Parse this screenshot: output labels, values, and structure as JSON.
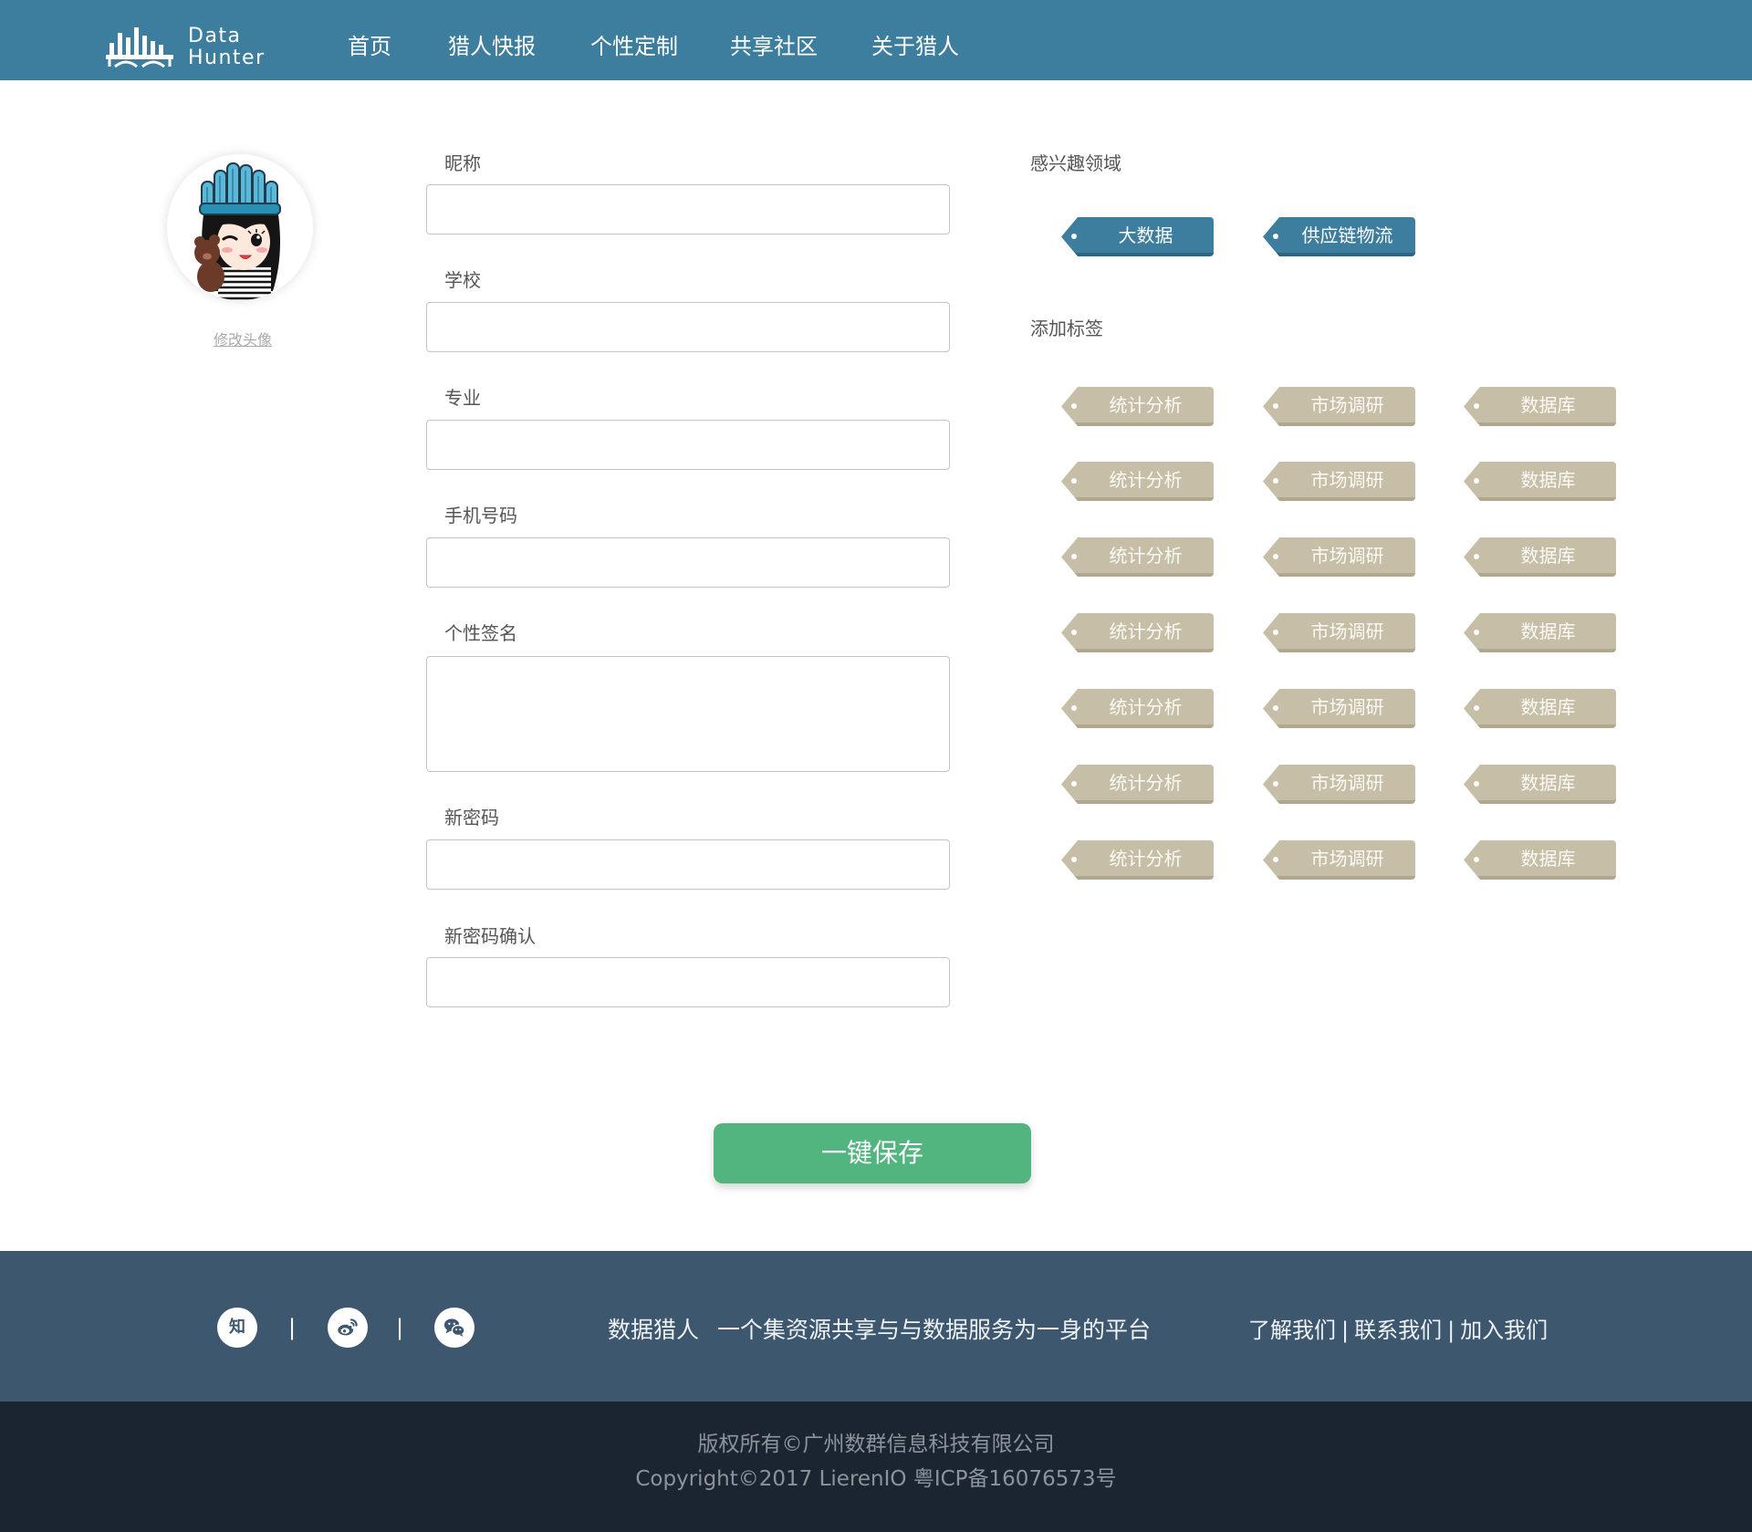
{
  "colors": {
    "header_bg": "#3d7d9d",
    "selected_tag": "#3d7d9d",
    "add_tag": "#c6bea6",
    "save_button": "#52b57f",
    "footer_bg": "#3d576f",
    "copyright_bg": "#1b2532"
  },
  "header": {
    "logo": {
      "line1": "Data",
      "line2": "Hunter",
      "icon": "skyline-bars-icon"
    },
    "nav": [
      {
        "label": "首页"
      },
      {
        "label": "猎人快报"
      },
      {
        "label": "个性定制"
      },
      {
        "label": "共享社区"
      },
      {
        "label": "关于猎人"
      }
    ]
  },
  "profile": {
    "avatar": "cartoon-girl-avatar",
    "change_avatar_link": "修改头像"
  },
  "form": {
    "fields": [
      {
        "label": "昵称",
        "value": ""
      },
      {
        "label": "学校",
        "value": ""
      },
      {
        "label": "专业",
        "value": ""
      },
      {
        "label": "手机号码",
        "value": ""
      },
      {
        "label": "个性签名",
        "value": ""
      },
      {
        "label": "新密码",
        "value": ""
      },
      {
        "label": "新密码确认",
        "value": ""
      }
    ]
  },
  "interests": {
    "title": "感兴趣领域",
    "selected_tags": [
      "大数据",
      "供应链物流"
    ]
  },
  "add_tags": {
    "title": "添加标签",
    "rows": [
      [
        "统计分析",
        "市场调研",
        "数据库"
      ],
      [
        "统计分析",
        "市场调研",
        "数据库"
      ],
      [
        "统计分析",
        "市场调研",
        "数据库"
      ],
      [
        "统计分析",
        "市场调研",
        "数据库"
      ],
      [
        "统计分析",
        "市场调研",
        "数据库"
      ],
      [
        "统计分析",
        "市场调研",
        "数据库"
      ],
      [
        "统计分析",
        "市场调研",
        "数据库"
      ]
    ]
  },
  "save_button": {
    "label": "一键保存"
  },
  "footer": {
    "social": [
      {
        "icon": "zhihu-icon",
        "glyph": "知"
      },
      {
        "icon": "weibo-icon"
      },
      {
        "icon": "wechat-icon"
      }
    ],
    "separator": "|",
    "brand": "数据猎人",
    "slogan": "一个集资源共享与与数据服务为一身的平台",
    "links": [
      "了解我们",
      "联系我们",
      "加入我们"
    ],
    "link_separator": "|"
  },
  "copyright": {
    "line1": "版权所有©广州数群信息科技有限公司",
    "line2": "Copyright©2017 LierenIO 粤ICP备16076573号"
  }
}
